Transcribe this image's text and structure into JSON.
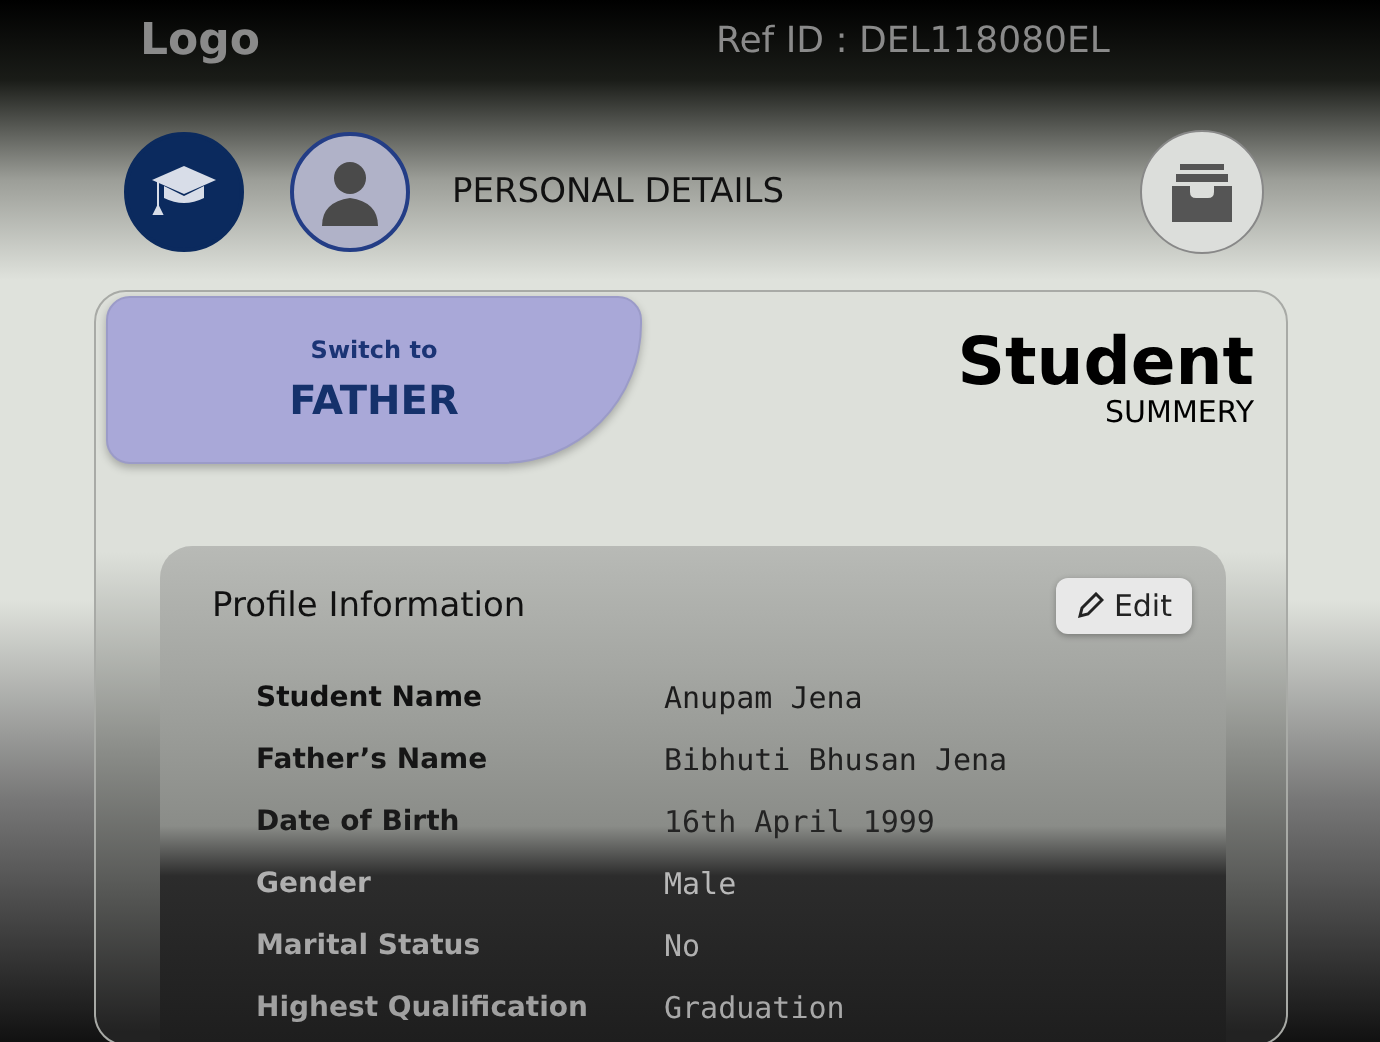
{
  "header": {
    "logo": "Logo",
    "ref_id": "Ref ID : DEL118080EL"
  },
  "nav": {
    "title": "PERSONAL DETAILS",
    "steps": [
      {
        "kind": "education",
        "selected": true
      },
      {
        "kind": "person",
        "selected": false
      }
    ]
  },
  "switch_tab": {
    "caption": "Switch to",
    "target": "FATHER"
  },
  "summary": {
    "title": "Student",
    "subtitle": "SUMMERY"
  },
  "profile": {
    "title": "Profile Information",
    "edit_button": "Edit",
    "rows": [
      {
        "label": "Student Name",
        "value": "Anupam Jena"
      },
      {
        "label": "Father’s Name",
        "value": "Bibhuti Bhusan Jena"
      },
      {
        "label": "Date of Birth",
        "value": "16th April 1999"
      },
      {
        "label": "Gender",
        "value": "Male"
      },
      {
        "label": "Marital Status",
        "value": "No"
      },
      {
        "label": "Highest Qualification",
        "value": "Graduation"
      }
    ]
  }
}
